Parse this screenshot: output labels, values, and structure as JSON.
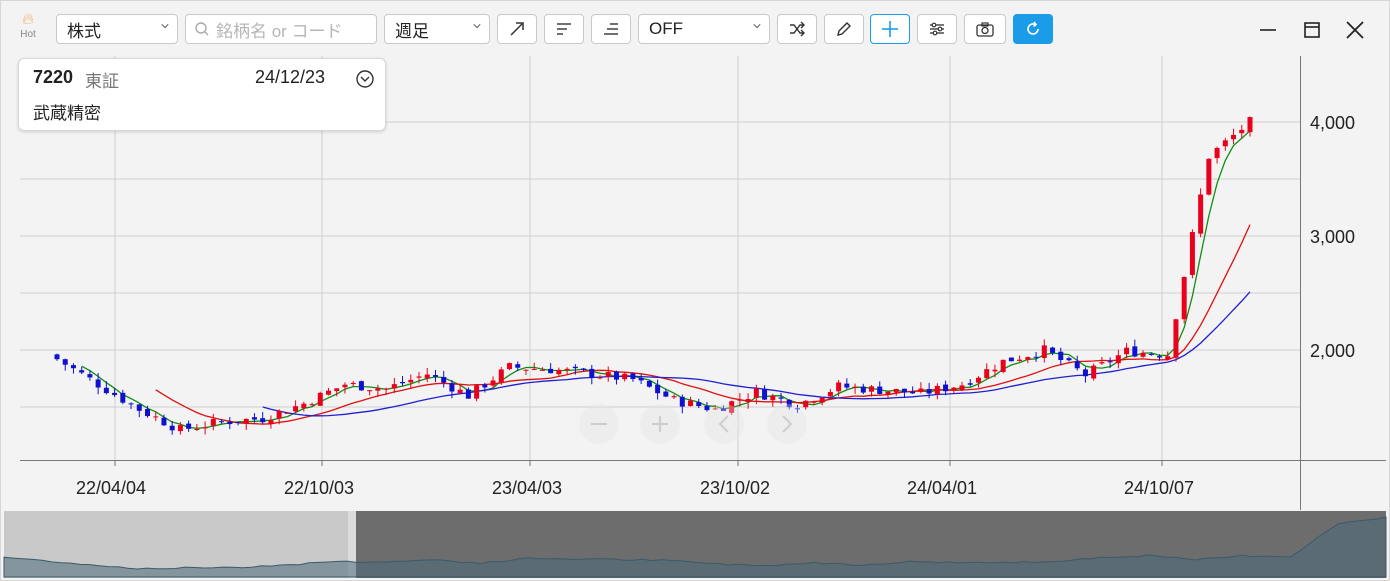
{
  "toolbar": {
    "hot_label": "Hot",
    "asset_type": "株式",
    "search_placeholder": "銘柄名 or コード",
    "period": "週足",
    "indicator": "OFF",
    "icons": [
      "trend-line-icon",
      "horizontal-line-icon",
      "horizontal-bottom-line-icon",
      "shuffle-icon",
      "pencil-icon",
      "crosshair-icon",
      "settings-sliders-icon",
      "camera-icon",
      "refresh-icon"
    ]
  },
  "window_controls": [
    "minimize-icon",
    "maximize-icon",
    "close-icon"
  ],
  "info": {
    "code": "7220",
    "market": "東証",
    "date": "24/12/23",
    "name": "武蔵精密"
  },
  "axis": {
    "y_ticks": [
      "4,000",
      "3,000",
      "2,000"
    ],
    "x_ticks": [
      "22/04/04",
      "22/10/03",
      "23/04/03",
      "23/10/02",
      "24/04/01",
      "24/10/07"
    ]
  },
  "colors": {
    "up": "#e8001c",
    "down": "#1010d0",
    "ma_short": "#109010",
    "ma_mid": "#e01010",
    "ma_long": "#2020d0",
    "accent": "#1a9ce8"
  },
  "zoom_controls": [
    "minus-icon",
    "plus-icon",
    "chevron-left-icon",
    "chevron-right-icon"
  ],
  "chart_data": {
    "type": "candlestick",
    "ylim": [
      1200,
      4500
    ],
    "y_ticks": [
      2000,
      3000,
      4000
    ],
    "x_ticks": [
      "22/04/04",
      "22/10/03",
      "23/04/03",
      "23/10/02",
      "24/04/01",
      "24/10/07"
    ],
    "close_anchors": [
      [
        "22/02",
        1920
      ],
      [
        "22/03",
        1700
      ],
      [
        "22/04",
        1480
      ],
      [
        "22/05",
        1300
      ],
      [
        "22/06",
        1370
      ],
      [
        "22/08",
        1400
      ],
      [
        "22/09",
        1530
      ],
      [
        "22/10",
        1700
      ],
      [
        "22/12",
        1660
      ],
      [
        "23/01",
        1790
      ],
      [
        "23/03",
        1600
      ],
      [
        "23/05",
        1850
      ],
      [
        "23/06",
        1830
      ],
      [
        "23/08",
        1790
      ],
      [
        "23/09",
        1740
      ],
      [
        "23/10",
        1560
      ],
      [
        "23/11",
        1480
      ],
      [
        "23/12",
        1630
      ],
      [
        "24/01",
        1520
      ],
      [
        "24/02",
        1680
      ],
      [
        "24/03",
        1650
      ],
      [
        "24/04",
        1620
      ],
      [
        "24/05",
        1700
      ],
      [
        "24/06",
        1900
      ],
      [
        "24/07",
        2000
      ],
      [
        "24/08",
        1780
      ],
      [
        "24/09",
        1990
      ],
      [
        "24/10",
        1960
      ],
      [
        "24/11",
        3700
      ],
      [
        "24/12",
        4000
      ]
    ],
    "ma_short_label": "",
    "ma_mid_label": "",
    "ma_long_label": ""
  }
}
